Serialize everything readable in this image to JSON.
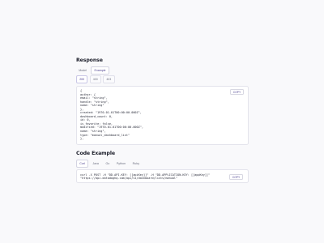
{
  "response": {
    "title": "Response",
    "view_tabs": [
      {
        "label": "Model",
        "active": false
      },
      {
        "label": "Example",
        "active": true
      }
    ],
    "status_tabs": [
      {
        "label": "200",
        "active": true
      },
      {
        "label": "400",
        "active": false
      },
      {
        "label": "403",
        "active": false
      }
    ],
    "copy_label": "COPY",
    "code_lines": [
      "{",
      "author: {",
      "email: \"string\",",
      "handle: \"string\",",
      "name: \"string\"",
      "},",
      "created: \"1970-01-01T00:00:00.000Z\",",
      "dashboard_count: 0,",
      "id: 0,",
      "is_favorite: false,",
      "modified: \"1970-01-01T00:00:00.000Z\",",
      "name: \"string\",",
      "type: \"manual_dashboard_list\"",
      "},"
    ]
  },
  "code_example": {
    "title": "Code Example",
    "lang_tabs": [
      {
        "label": "Curl",
        "active": true
      },
      {
        "label": "Java",
        "active": false
      },
      {
        "label": "Go",
        "active": false
      },
      {
        "label": "Python",
        "active": false
      },
      {
        "label": "Ruby",
        "active": false
      }
    ],
    "copy_label": "COPY",
    "code_lines": [
      "curl -X POST -H \"DD-API-KEY: [[apiKey]]\" -H \"DD-APPLICATION-KEY: [[appKey]]\"",
      "\"https://api.datadoghq.com/api/v1/dashboard/lists/manual\""
    ]
  }
}
